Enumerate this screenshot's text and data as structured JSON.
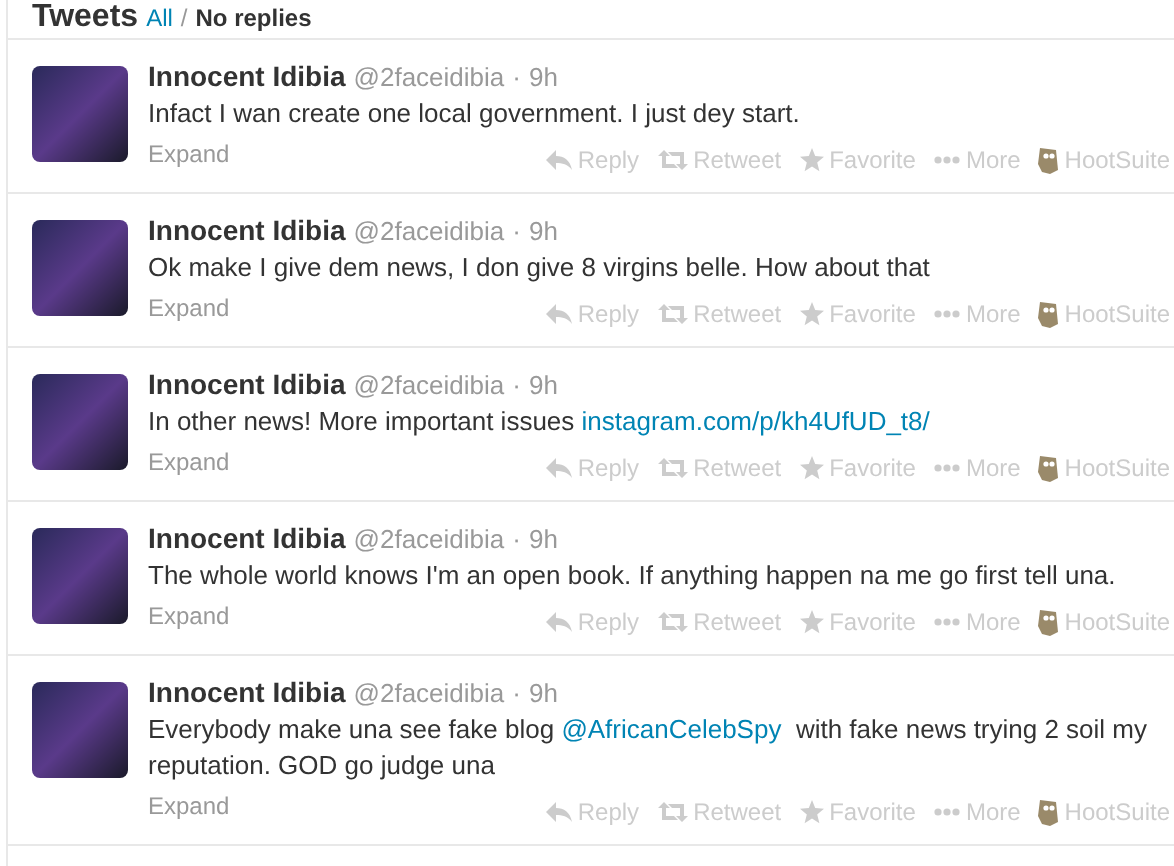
{
  "header": {
    "title": "Tweets",
    "filters": [
      {
        "label": "All",
        "selected": false
      },
      {
        "label": "No replies",
        "selected": true
      }
    ],
    "separator": "/"
  },
  "tweets": [
    {
      "name": "Innocent Idibia",
      "handle": "@2faceidibia",
      "dot": "·",
      "time": "9h",
      "text": [
        {
          "kind": "text",
          "text": "Infact I wan create one local government. I just dey start."
        }
      ],
      "expand": "Expand",
      "actions": [
        {
          "kind": "reply",
          "label": "Reply"
        },
        {
          "kind": "retweet",
          "label": "Retweet"
        },
        {
          "kind": "favorite",
          "label": "Favorite"
        },
        {
          "kind": "more",
          "label": "More"
        },
        {
          "kind": "hootsuite",
          "label": "HootSuite"
        }
      ]
    },
    {
      "name": "Innocent Idibia",
      "handle": "@2faceidibia",
      "dot": "·",
      "time": "9h",
      "text": [
        {
          "kind": "text",
          "text": "Ok make I give dem news, I don give 8 virgins belle. How about that"
        }
      ],
      "expand": "Expand",
      "actions": [
        {
          "kind": "reply",
          "label": "Reply"
        },
        {
          "kind": "retweet",
          "label": "Retweet"
        },
        {
          "kind": "favorite",
          "label": "Favorite"
        },
        {
          "kind": "more",
          "label": "More"
        },
        {
          "kind": "hootsuite",
          "label": "HootSuite"
        }
      ]
    },
    {
      "name": "Innocent Idibia",
      "handle": "@2faceidibia",
      "dot": "·",
      "time": "9h",
      "text": [
        {
          "kind": "text",
          "text": "In other news! More important issues "
        },
        {
          "kind": "link",
          "text": "instagram.com/p/kh4UfUD_t8/"
        }
      ],
      "expand": "Expand",
      "actions": [
        {
          "kind": "reply",
          "label": "Reply"
        },
        {
          "kind": "retweet",
          "label": "Retweet"
        },
        {
          "kind": "favorite",
          "label": "Favorite"
        },
        {
          "kind": "more",
          "label": "More"
        },
        {
          "kind": "hootsuite",
          "label": "HootSuite"
        }
      ]
    },
    {
      "name": "Innocent Idibia",
      "handle": "@2faceidibia",
      "dot": "·",
      "time": "9h",
      "text": [
        {
          "kind": "text",
          "text": "The whole world knows I'm an open book. If anything happen na me go first tell una."
        }
      ],
      "expand": "Expand",
      "actions": [
        {
          "kind": "reply",
          "label": "Reply"
        },
        {
          "kind": "retweet",
          "label": "Retweet"
        },
        {
          "kind": "favorite",
          "label": "Favorite"
        },
        {
          "kind": "more",
          "label": "More"
        },
        {
          "kind": "hootsuite",
          "label": "HootSuite"
        }
      ]
    },
    {
      "name": "Innocent Idibia",
      "handle": "@2faceidibia",
      "dot": "·",
      "time": "9h",
      "text": [
        {
          "kind": "text",
          "text": "Everybody make una see fake blog "
        },
        {
          "kind": "link",
          "text": "@AfricanCelebSpy"
        },
        {
          "kind": "text",
          "text": "  with fake news trying 2 soil my reputation. GOD go judge una"
        }
      ],
      "expand": "Expand",
      "actions": [
        {
          "kind": "reply",
          "label": "Reply"
        },
        {
          "kind": "retweet",
          "label": "Retweet"
        },
        {
          "kind": "favorite",
          "label": "Favorite"
        },
        {
          "kind": "more",
          "label": "More"
        },
        {
          "kind": "hootsuite",
          "label": "HootSuite"
        }
      ]
    }
  ]
}
